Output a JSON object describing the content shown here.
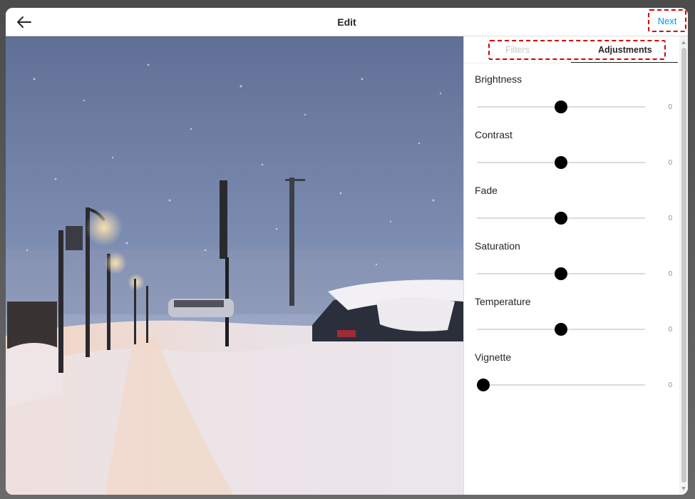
{
  "header": {
    "title": "Edit",
    "next_label": "Next",
    "back_icon": "arrow-left-icon"
  },
  "tabs": [
    {
      "label": "Filters",
      "active": false
    },
    {
      "label": "Adjustments",
      "active": true
    }
  ],
  "adjustments": [
    {
      "label": "Brightness",
      "value": "0",
      "position": 0.5
    },
    {
      "label": "Contrast",
      "value": "0",
      "position": 0.5
    },
    {
      "label": "Fade",
      "value": "0",
      "position": 0.5
    },
    {
      "label": "Saturation",
      "value": "0",
      "position": 0.5
    },
    {
      "label": "Temperature",
      "value": "0",
      "position": 0.5
    },
    {
      "label": "Vignette",
      "value": "0",
      "position": 0.0
    }
  ],
  "colors": {
    "accent": "#0095f6",
    "highlight": "#d40000",
    "text": "#262626"
  }
}
